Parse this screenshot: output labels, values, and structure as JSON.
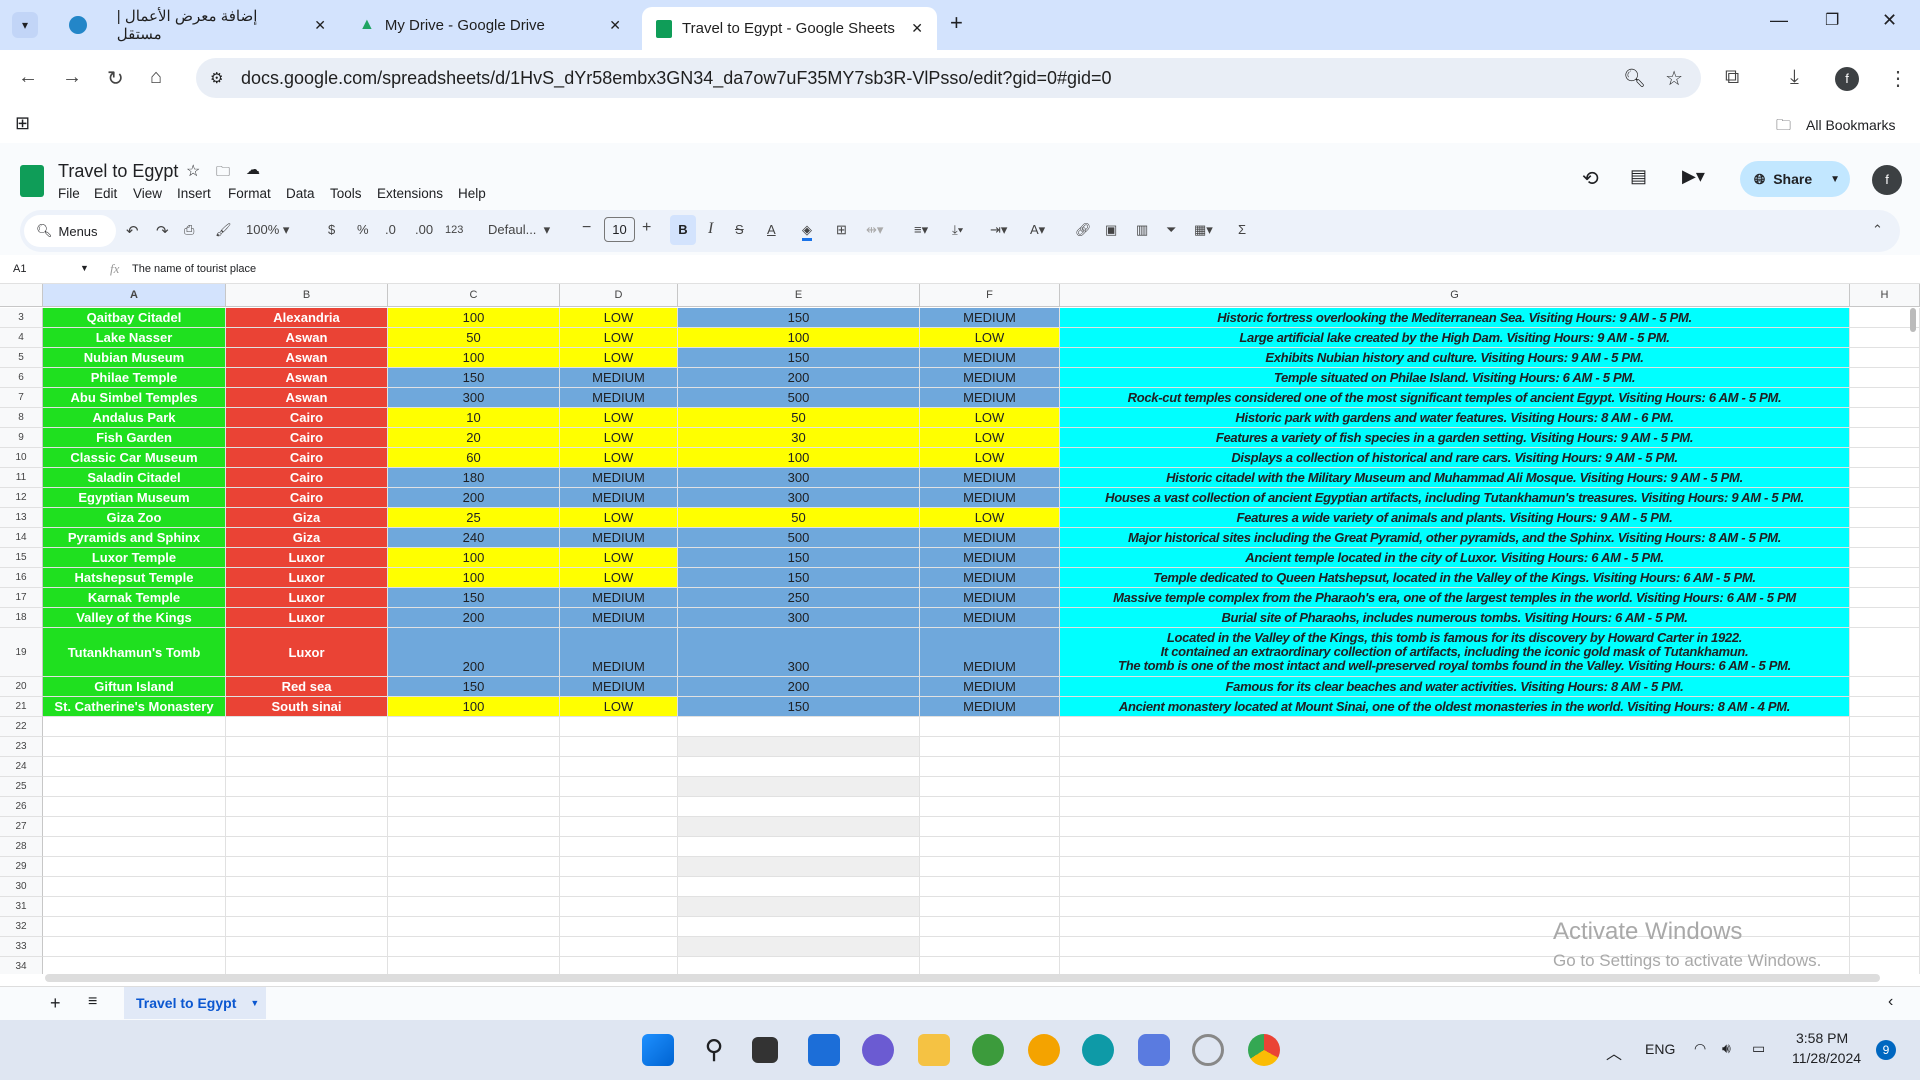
{
  "browser": {
    "tabs": [
      {
        "label": "إضافة معرض الأعمال | مستقل"
      },
      {
        "label": "My Drive - Google Drive"
      },
      {
        "label": "Travel to Egypt - Google Sheets"
      }
    ],
    "url": "docs.google.com/spreadsheets/d/1HvS_dYr58embx3GN34_da7ow7uF35MY7sb3R-VlPsso/edit?gid=0#gid=0",
    "all_bookmarks": "All Bookmarks",
    "profile_initial": "f"
  },
  "doc": {
    "title": "Travel to Egypt",
    "menus": [
      "File",
      "Edit",
      "View",
      "Insert",
      "Format",
      "Data",
      "Tools",
      "Extensions",
      "Help"
    ],
    "share_label": "Share",
    "toolbar": {
      "search": "Menus",
      "zoom": "100%",
      "currency": "$",
      "percent": "%",
      "dec_less": ".0",
      "dec_more": ".00",
      "format": "123",
      "font": "Defaul...",
      "font_size": "10"
    },
    "cell_ref": "A1",
    "formula": "The name of tourist place"
  },
  "sheet": {
    "columns": [
      "A",
      "B",
      "C",
      "D",
      "E",
      "F",
      "G",
      "H"
    ],
    "colors": {
      "A": "#1fe01f",
      "B": "#ea4335",
      "low": "#ffff00",
      "medium": "#6fa8dc",
      "G": "#00ffff"
    },
    "rows": [
      {
        "n": "3",
        "cells": [
          "Qaitbay Citadel",
          "Alexandria",
          "100",
          "LOW",
          "150",
          "MEDIUM",
          "Historic fortress overlooking the Mediterranean Sea. Visiting Hours: 9 AM - 5 PM."
        ]
      },
      {
        "n": "4",
        "cells": [
          "Lake Nasser",
          "Aswan",
          "50",
          "LOW",
          "100",
          "LOW",
          "Large artificial lake created by the High Dam. Visiting Hours: 9 AM - 5 PM."
        ]
      },
      {
        "n": "5",
        "cells": [
          "Nubian Museum",
          "Aswan",
          "100",
          "LOW",
          "150",
          "MEDIUM",
          "Exhibits Nubian history and culture. Visiting Hours: 9 AM - 5 PM."
        ]
      },
      {
        "n": "6",
        "cells": [
          "Philae Temple",
          "Aswan",
          "150",
          "MEDIUM",
          "200",
          "MEDIUM",
          "Temple situated on Philae Island. Visiting Hours: 6 AM - 5 PM."
        ]
      },
      {
        "n": "7",
        "cells": [
          "Abu Simbel Temples",
          "Aswan",
          "300",
          "MEDIUM",
          "500",
          "MEDIUM",
          "Rock-cut temples considered one of the most significant temples of ancient Egypt. Visiting Hours: 6 AM - 5 PM."
        ]
      },
      {
        "n": "8",
        "cells": [
          "Andalus Park",
          "Cairo",
          "10",
          "LOW",
          "50",
          "LOW",
          "Historic park with gardens and water features. Visiting Hours: 8 AM - 6 PM."
        ]
      },
      {
        "n": "9",
        "cells": [
          "Fish Garden",
          "Cairo",
          "20",
          "LOW",
          "30",
          "LOW",
          "Features a variety of fish species in a garden setting. Visiting Hours: 9 AM - 5 PM."
        ]
      },
      {
        "n": "10",
        "cells": [
          "Classic Car Museum",
          "Cairo",
          "60",
          "LOW",
          "100",
          "LOW",
          "Displays a collection of historical and rare cars. Visiting Hours: 9 AM - 5 PM."
        ]
      },
      {
        "n": "11",
        "cells": [
          "Saladin Citadel",
          "Cairo",
          "180",
          "MEDIUM",
          "300",
          "MEDIUM",
          "Historic citadel with the Military Museum and Muhammad Ali Mosque. Visiting Hours: 9 AM - 5 PM."
        ]
      },
      {
        "n": "12",
        "cells": [
          "Egyptian Museum",
          "Cairo",
          "200",
          "MEDIUM",
          "300",
          "MEDIUM",
          "Houses a vast collection of ancient Egyptian artifacts, including Tutankhamun's treasures. Visiting Hours: 9 AM - 5 PM."
        ]
      },
      {
        "n": "13",
        "cells": [
          "Giza Zoo",
          "Giza",
          "25",
          "LOW",
          "50",
          "LOW",
          "Features a wide variety of animals and plants. Visiting Hours: 9 AM - 5 PM."
        ]
      },
      {
        "n": "14",
        "cells": [
          "Pyramids and Sphinx",
          "Giza",
          "240",
          "MEDIUM",
          "500",
          "MEDIUM",
          "Major historical sites including the Great Pyramid, other pyramids, and the Sphinx. Visiting Hours: 8 AM - 5 PM."
        ]
      },
      {
        "n": "15",
        "cells": [
          "Luxor Temple",
          "Luxor",
          "100",
          "LOW",
          "150",
          "MEDIUM",
          "Ancient temple located in the city of Luxor. Visiting Hours: 6 AM - 5 PM."
        ]
      },
      {
        "n": "16",
        "cells": [
          "Hatshepsut Temple",
          "Luxor",
          "100",
          "LOW",
          "150",
          "MEDIUM",
          "Temple dedicated to Queen Hatshepsut, located in the Valley of the Kings. Visiting Hours: 6 AM - 5 PM."
        ]
      },
      {
        "n": "17",
        "cells": [
          "Karnak Temple",
          "Luxor",
          "150",
          "MEDIUM",
          "250",
          "MEDIUM",
          "Massive temple complex from the Pharaoh's era, one of the largest temples in the world. Visiting Hours: 6 AM - 5 PM"
        ]
      },
      {
        "n": "18",
        "cells": [
          "Valley of the Kings",
          "Luxor",
          "200",
          "MEDIUM",
          "300",
          "MEDIUM",
          "Burial site of Pharaohs, includes numerous tombs. Visiting Hours: 6 AM - 5 PM."
        ]
      },
      {
        "n": "19",
        "cells": [
          "Tutankhamun's Tomb",
          "Luxor",
          "200",
          "MEDIUM",
          "300",
          "MEDIUM",
          "Located in the Valley of the Kings, this tomb is famous for its discovery by Howard Carter in 1922.\nIt contained an extraordinary collection of artifacts, including the iconic gold mask of Tutankhamun.\nThe tomb is one of the most intact and well-preserved royal tombs found in the Valley. Visiting Hours: 6 AM - 5 PM."
        ]
      },
      {
        "n": "20",
        "cells": [
          "Giftun Island",
          "Red sea",
          "150",
          "MEDIUM",
          "200",
          "MEDIUM",
          "Famous for its clear beaches and water activities. Visiting Hours: 8 AM - 5 PM."
        ]
      },
      {
        "n": "21",
        "cells": [
          "St. Catherine's Monastery",
          "South sinai",
          "100",
          "LOW",
          "150",
          "MEDIUM",
          "Ancient monastery located at Mount Sinai, one of the oldest monasteries in the world. Visiting Hours: 8 AM - 4 PM."
        ]
      }
    ],
    "empty_rows": [
      "22",
      "23",
      "24",
      "25",
      "26",
      "27",
      "28",
      "29",
      "30",
      "31",
      "32",
      "33",
      "34"
    ],
    "sheet_tab": "Travel to Egypt"
  },
  "watermark": {
    "line1": "Activate Windows",
    "line2": "Go to Settings to activate Windows."
  },
  "taskbar": {
    "lang": "ENG",
    "time": "3:58 PM",
    "date": "11/28/2024",
    "badge": "9"
  }
}
